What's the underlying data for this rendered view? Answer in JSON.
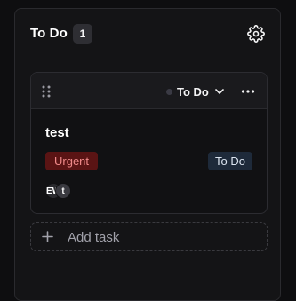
{
  "column": {
    "title": "To Do",
    "count": "1",
    "settings_icon": "gear-icon"
  },
  "card": {
    "drag_icon": "drag-handle-icon",
    "status": "To Do",
    "status_icon": "chevron-down-icon",
    "more_icon": "more-horizontal-icon",
    "title": "test",
    "priority": "Urgent",
    "status_badge": "To Do",
    "assignees": [
      "EW",
      "t"
    ],
    "colors": {
      "priority_bg": "#5a1414",
      "priority_text": "#f08a8a",
      "status_bg": "#1e2a3a"
    }
  },
  "add_task": {
    "label": "Add task",
    "icon": "plus-icon"
  }
}
